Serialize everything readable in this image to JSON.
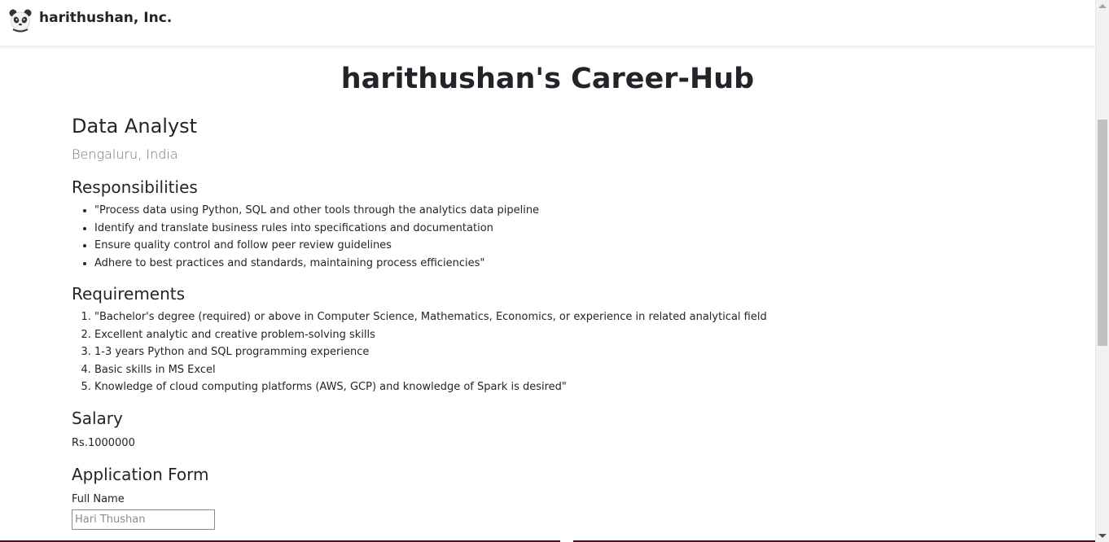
{
  "navbar": {
    "brand_name": "harithushan, Inc.",
    "logo_icon": "panda-icon"
  },
  "page": {
    "title": "harithushan's Career-Hub"
  },
  "job": {
    "title": "Data Analyst",
    "location": "Bengaluru, India",
    "responsibilities_heading": "Responsibilities",
    "responsibilities": [
      "\"Process data using Python, SQL and other tools through the analytics data pipeline",
      "Identify and translate business rules into specifications and documentation",
      "Ensure quality control and follow peer review guidelines",
      "Adhere to best practices and standards, maintaining process efficiencies\""
    ],
    "requirements_heading": "Requirements",
    "requirements": [
      "\"Bachelor's degree (required) or above in Computer Science, Mathematics, Economics, or experience in related analytical field",
      "Excellent analytic and creative problem-solving skills",
      "1-3 years Python and SQL programming experience",
      "Basic skills in MS Excel",
      "Knowledge of cloud computing platforms (AWS, GCP) and knowledge of Spark is desired\""
    ],
    "salary_heading": "Salary",
    "salary": "Rs.1000000"
  },
  "application_form": {
    "heading": "Application Form",
    "full_name_label": "Full Name",
    "full_name_placeholder": "Hari Thushan",
    "full_name_value": ""
  },
  "colors": {
    "text": "#212529",
    "muted": "#6c757d",
    "footer_accent": "#4a1020"
  }
}
